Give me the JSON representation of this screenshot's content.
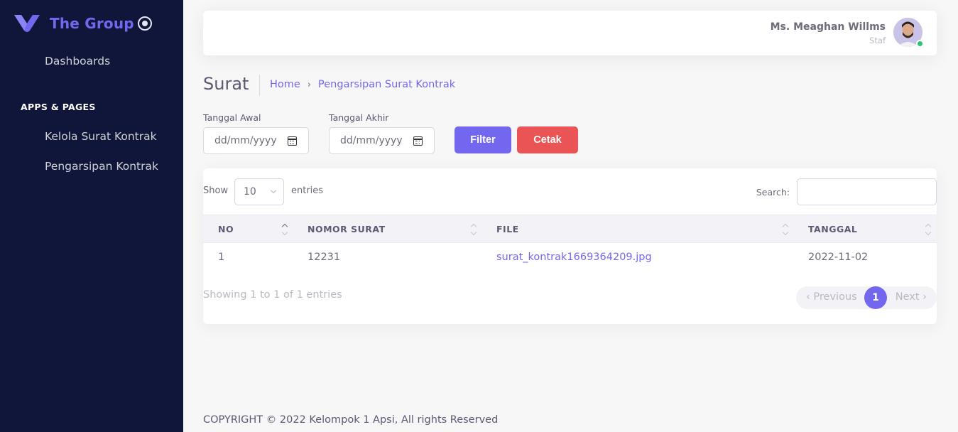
{
  "sidebar": {
    "brand": "The Group",
    "items": [
      {
        "label": "Dashboards"
      },
      {
        "label": "Kelola Surat Kontrak"
      },
      {
        "label": "Pengarsipan Kontrak"
      }
    ],
    "section_header": "APPS & PAGES"
  },
  "navbar": {
    "user_name": "Ms. Meaghan Willms",
    "user_role": "Staf"
  },
  "page": {
    "title": "Surat",
    "breadcrumb": [
      "Home",
      "Pengarsipan Surat Kontrak"
    ],
    "breadcrumb_separator": "›"
  },
  "filter": {
    "start_label": "Tanggal Awal",
    "start_placeholder": "dd/mm/yyyy",
    "end_label": "Tanggal Akhir",
    "end_placeholder": "dd/mm/yyyy",
    "filter_button": "Filter",
    "print_button": "Cetak"
  },
  "table": {
    "show_label": "Show",
    "page_length": "10",
    "entries_label": "entries",
    "search_label": "Search:",
    "columns": [
      "NO",
      "NOMOR SURAT",
      "FILE",
      "TANGGAL"
    ],
    "rows": [
      {
        "no": "1",
        "nomor_surat": "12231",
        "file": "surat_kontrak1669364209.jpg",
        "tanggal": "2022-11-02"
      }
    ],
    "info": "Showing 1 to 1 of 1 entries",
    "pagination": {
      "previous": "Previous",
      "current": "1",
      "next": "Next"
    }
  },
  "footer": {
    "text": "COPYRIGHT © 2022 Kelompok 1 Apsi, All rights Reserved"
  },
  "colors": {
    "primary": "#7367f0",
    "danger": "#ea5455",
    "sidebar_bg": "#10163a",
    "online": "#28c76f"
  }
}
